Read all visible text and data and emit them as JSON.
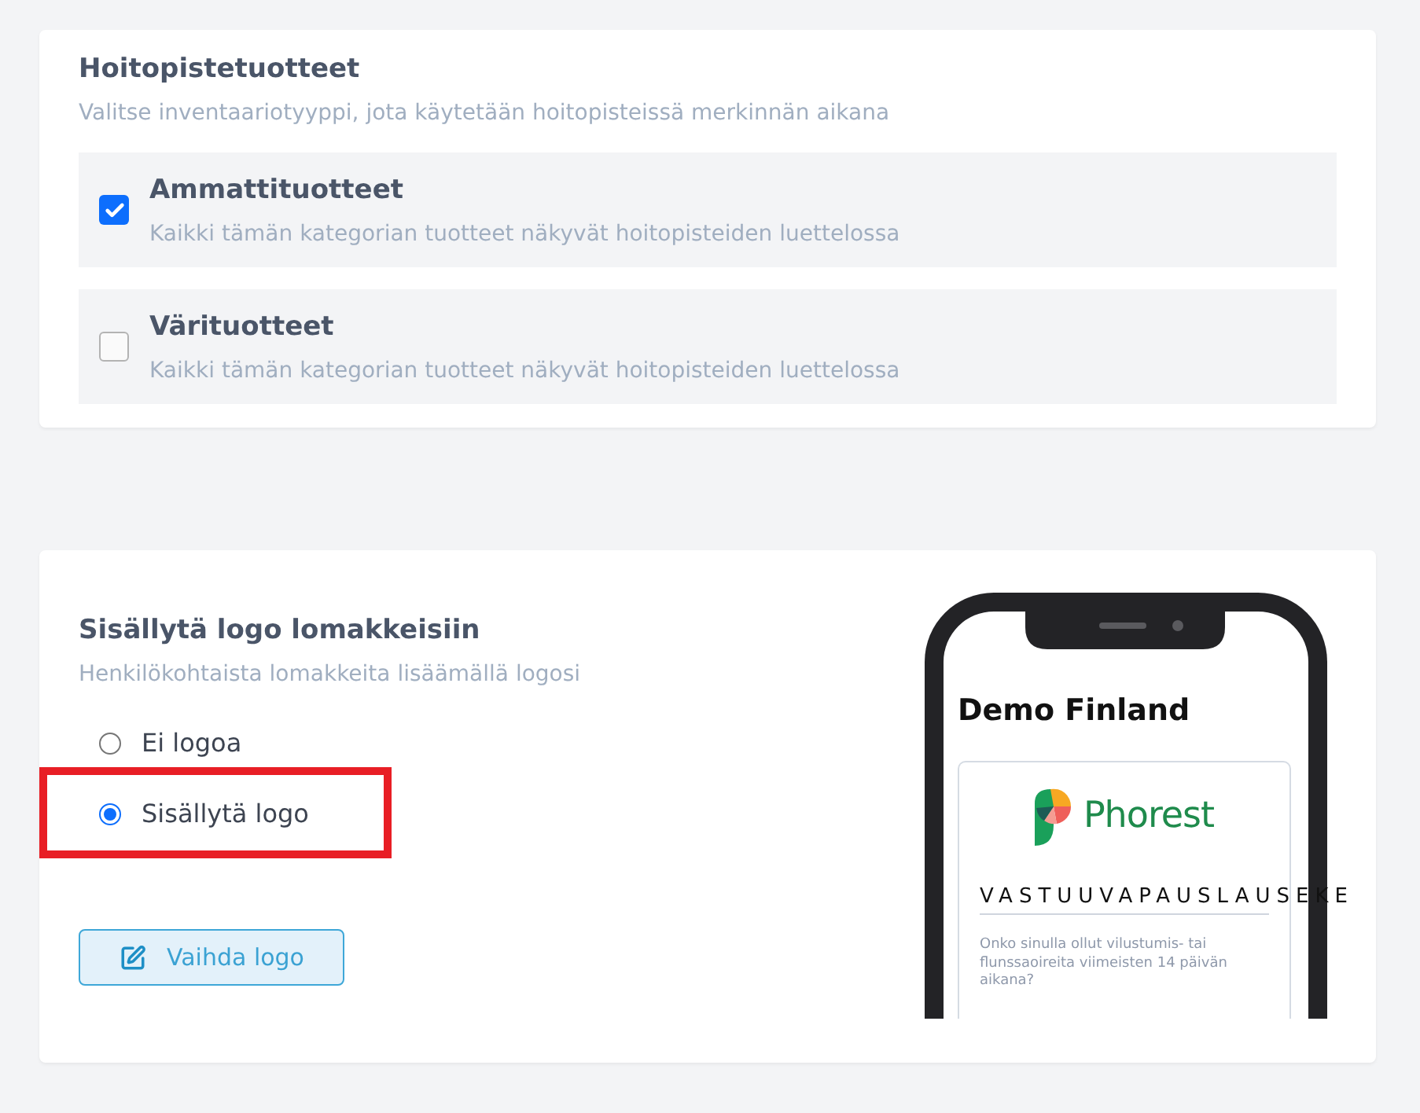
{
  "inventory": {
    "title": "Hoitopistetuotteet",
    "subtitle": "Valitse inventaariotyyppi, jota käytetään hoitopisteissä merkinnän aikana",
    "options": [
      {
        "label": "Ammattituotteet",
        "description": "Kaikki tämän kategorian tuotteet näkyvät hoitopisteiden luettelossa",
        "checked": true
      },
      {
        "label": "Värituotteet",
        "description": "Kaikki tämän kategorian tuotteet näkyvät hoitopisteiden luettelossa",
        "checked": false
      }
    ]
  },
  "logo_settings": {
    "title": "Sisällytä logo lomakkeisiin",
    "subtitle": "Henkilökohtaista lomakkeita lisäämällä logosi",
    "options": [
      {
        "label": "Ei logoa",
        "selected": false,
        "highlighted": false
      },
      {
        "label": "Sisällytä logo",
        "selected": true,
        "highlighted": true
      }
    ],
    "button": "Vaihda logo"
  },
  "preview": {
    "title": "Demo Finland",
    "logo_text": "Phorest",
    "heading": "VASTUUVAPAUSLAUSEKE",
    "question": "Onko sinulla ollut vilustumis- tai flunssaoireita viimeisten 14 päivän aikana?"
  }
}
